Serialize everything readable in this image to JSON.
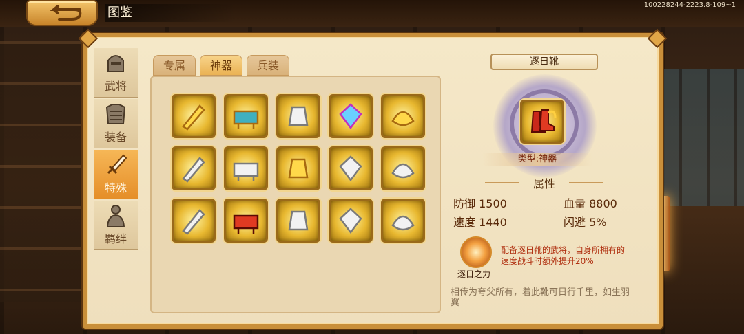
{
  "header": {
    "title": "图鉴",
    "version": "100228244-2223.8-109~1"
  },
  "sidenav": {
    "items": [
      {
        "label": "武将",
        "icon": "helmet-icon",
        "active": false
      },
      {
        "label": "装备",
        "icon": "armor-icon",
        "active": false
      },
      {
        "label": "特殊",
        "icon": "sword-icon",
        "active": true
      },
      {
        "label": "羁绊",
        "icon": "figure-icon",
        "active": false
      }
    ]
  },
  "tabs": [
    {
      "label": "专属",
      "active": false
    },
    {
      "label": "神器",
      "active": true
    },
    {
      "label": "兵装",
      "active": false
    }
  ],
  "grid": {
    "items": [
      {
        "icon": "golden-sword-icon"
      },
      {
        "icon": "treasure-cauldron-icon"
      },
      {
        "icon": "silver-bell-icon"
      },
      {
        "icon": "rainbow-gem-icon"
      },
      {
        "icon": "golden-bow-icon"
      },
      {
        "icon": "silver-orb-icon"
      },
      {
        "icon": "silver-axe-icon"
      },
      {
        "icon": "golden-pagoda-icon"
      },
      {
        "icon": "silver-tower-icon"
      },
      {
        "icon": "silver-temple-icon"
      },
      {
        "icon": "silver-bow-icon"
      },
      {
        "icon": "red-boots-icon"
      },
      {
        "icon": "silver-torch-icon"
      },
      {
        "icon": "silver-pouch-icon"
      },
      {
        "icon": "silver-mask-icon"
      }
    ]
  },
  "detail": {
    "name": "逐日靴",
    "icon": "red-boots-icon",
    "type_label": "类型:神器",
    "attr_heading": "属性",
    "stats": {
      "defense": "防御 1500",
      "hp": "血量 8800",
      "speed": "速度 1440",
      "dodge": "闪避 5%"
    },
    "skill": {
      "name": "逐日之力",
      "description": "配备逐日靴的武将，自身所拥有的速度战斗时额外提升20%"
    },
    "lore": "相传为夸父所有，着此靴可日行千里，如生羽翼"
  },
  "colors": {
    "panel_border": "#c98f3a",
    "active_tab": "#eab254",
    "skill_text": "#b03010"
  }
}
